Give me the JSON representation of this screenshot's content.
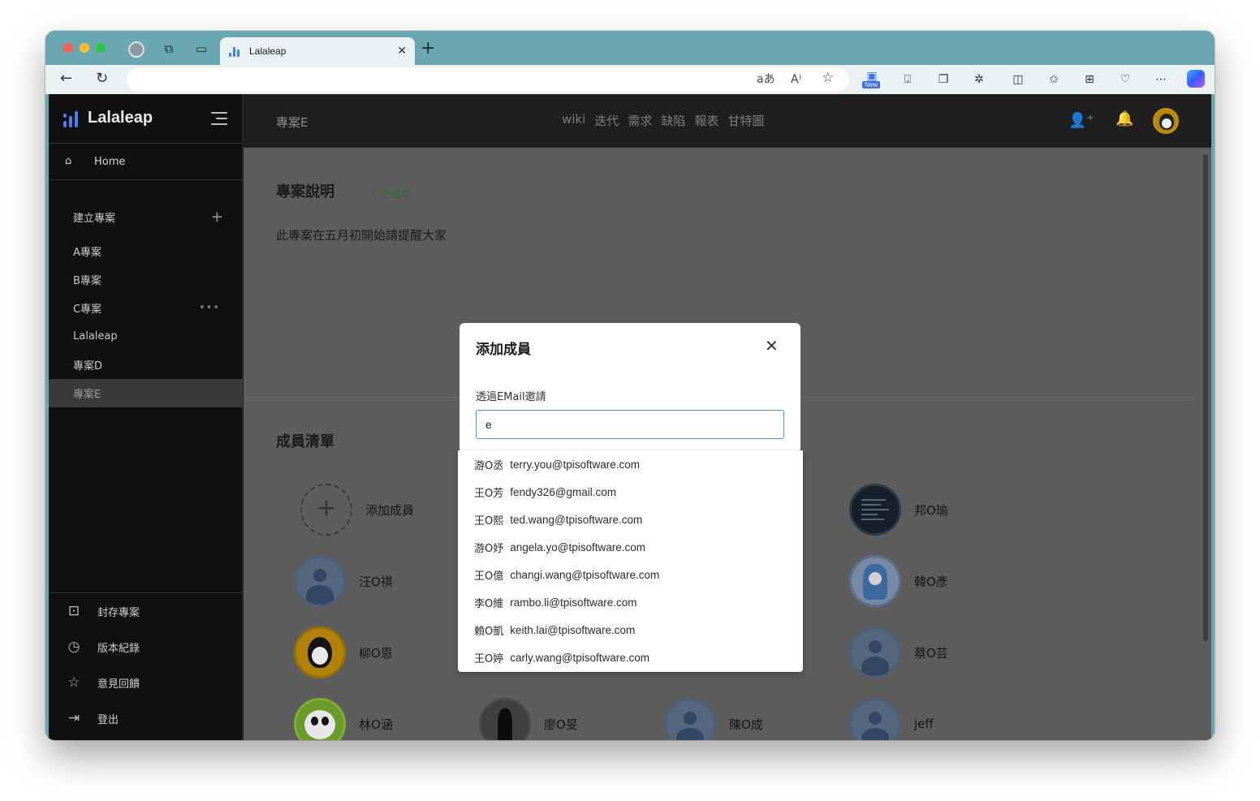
{
  "browser": {
    "tab_title": "Lalaleap",
    "new_badge": "New"
  },
  "sidebar": {
    "brand": "Lalaleap",
    "home": "Home",
    "create_project": "建立專案",
    "projects": [
      {
        "label": "A專案"
      },
      {
        "label": "B專案"
      },
      {
        "label": "C專案",
        "more": "•••"
      },
      {
        "label": "Lalaleap"
      },
      {
        "label": "專案D"
      },
      {
        "label": "專案E",
        "active": true
      }
    ],
    "bottom": [
      "封存專案",
      "版本紀錄",
      "意見回饋",
      "登出"
    ]
  },
  "topbar": {
    "project": "專案E",
    "nav": [
      "wiki",
      "迭代",
      "需求",
      "缺陷",
      "報表",
      "甘特圖"
    ]
  },
  "content": {
    "desc_title": "專案說明",
    "saved": "已儲存",
    "description": "此專案在五月初開始請提醒大家",
    "members_title": "成員清單",
    "members": [
      {
        "name": "添加成員"
      },
      {
        "name": "邦O瑜"
      },
      {
        "name": "汪O祺"
      },
      {
        "name": "韓O彥"
      },
      {
        "name": "柳O恩"
      },
      {
        "name": "蔡O芸"
      },
      {
        "name": "林O涵"
      },
      {
        "name": "廖O旻"
      },
      {
        "name": "陳O成"
      },
      {
        "name": "jeff"
      }
    ]
  },
  "modal": {
    "title": "添加成員",
    "label": "透過EMail邀請",
    "input_value": "e"
  },
  "suggestions": [
    {
      "name": "游O丞",
      "email": "terry.you@tpisoftware.com"
    },
    {
      "name": "王O芳",
      "email": "fendy326@gmail.com"
    },
    {
      "name": "王O熙",
      "email": "ted.wang@tpisoftware.com"
    },
    {
      "name": "游O妤",
      "email": "angela.yo@tpisoftware.com"
    },
    {
      "name": "王O億",
      "email": "changi.wang@tpisoftware.com"
    },
    {
      "name": "李O維",
      "email": "rambo.li@tpisoftware.com"
    },
    {
      "name": "賴O凱",
      "email": "keith.lai@tpisoftware.com"
    },
    {
      "name": "王O婷",
      "email": "carly.wang@tpisoftware.com"
    }
  ],
  "colors": {
    "accent": "#4a90e2",
    "saved": "#2f6b2f",
    "browser_frame": "#6aa7b2"
  }
}
